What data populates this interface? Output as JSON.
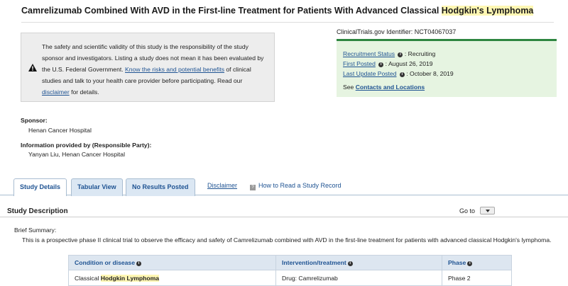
{
  "title": {
    "prefix": "Camrelizumab Combined With AVD in the First-line Treatment for Patients With Advanced Classical ",
    "highlight": "Hodgkin's Lymphoma"
  },
  "disclaimer": {
    "part1": "The safety and scientific validity of this study is the responsibility of the study sponsor and investigators. Listing a study does not mean it has been evaluated by the U.S. Federal Government. ",
    "link1": "Know the risks and potential benefits",
    "part2": " of clinical studies and talk to your health care provider before participating. Read our ",
    "link2": "disclaimer",
    "part3": " for details."
  },
  "identifier": "ClinicalTrials.gov Identifier: NCT04067037",
  "status": {
    "recruitment_label": "Recruitment Status",
    "recruitment_value": ": Recruiting",
    "first_posted_label": "First Posted",
    "first_posted_value": ": August 26, 2019",
    "last_update_label": "Last Update Posted",
    "last_update_value": ": October 8, 2019",
    "see": "See ",
    "contacts_link": "Contacts and Locations"
  },
  "sponsor": {
    "label": "Sponsor:",
    "value": "Henan Cancer Hospital"
  },
  "responsible": {
    "label": "Information provided by (Responsible Party):",
    "value": "Yanyan Liu, Henan Cancer Hospital"
  },
  "tabs": [
    {
      "label": "Study Details"
    },
    {
      "label": "Tabular View"
    },
    {
      "label": "No Results Posted"
    }
  ],
  "links": {
    "disclaimer": "Disclaimer",
    "how_to": "How to Read a Study Record"
  },
  "study_description": {
    "title": "Study Description",
    "goto": "Go to"
  },
  "brief": {
    "label": "Brief Summary:",
    "text": "This is a prospective phase II clinical trial to observe the efficacy and safety of Camrelizumab combined with AVD in the first-line treatment for patients with advanced classical Hodgkin's lymphoma."
  },
  "table": {
    "headers": [
      "Condition or disease",
      "Intervention/treatment",
      "Phase"
    ],
    "row": {
      "condition_prefix": "Classical ",
      "condition_highlight": "Hodgkin Lymphoma",
      "intervention": "Drug: Camrelizumab",
      "phase": "Phase 2"
    }
  },
  "colors": {
    "link": "#205493",
    "status_bg": "#e6f4e1",
    "status_border": "#2e8540",
    "highlight": "#fff7b3"
  }
}
